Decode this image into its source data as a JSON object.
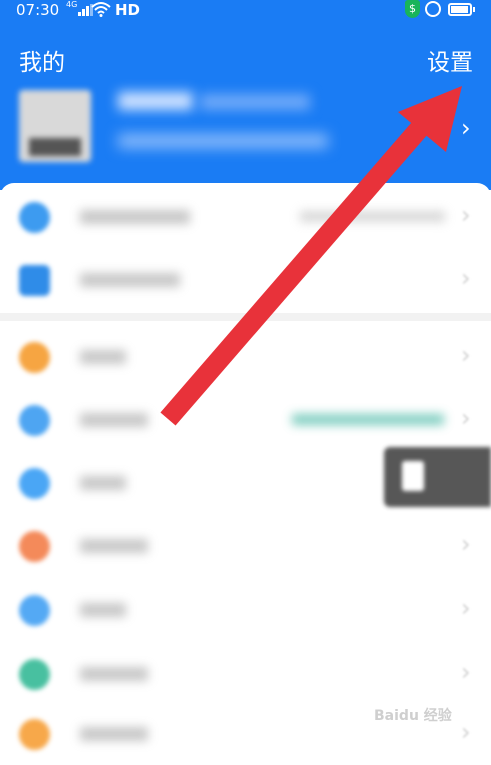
{
  "status_bar": {
    "time": "07:30",
    "signal_type": "4G",
    "network": "HD",
    "security_badge": "$"
  },
  "header": {
    "title": "我的",
    "settings_label": "设置",
    "background_color": "#1a7cf4"
  },
  "profile": {
    "chevron": "›"
  },
  "menu_groups": [
    {
      "items": [
        {
          "icon": "blue-circle-icon",
          "color": "#3d9bf0",
          "chevron": "›"
        },
        {
          "icon": "blue-doc-icon",
          "color": "#2f8ce8",
          "chevron": "›"
        }
      ]
    },
    {
      "items": [
        {
          "icon": "orange-circle-icon",
          "color": "#f6a542",
          "chevron": "›"
        },
        {
          "icon": "blue-circle-icon",
          "color": "#4ea5f2",
          "chevron": "›"
        },
        {
          "icon": "blue-circle-icon",
          "color": "#4aa6f5",
          "chevron": ""
        },
        {
          "icon": "orange-red-circle-icon",
          "color": "#f48a5a",
          "chevron": "›"
        },
        {
          "icon": "blue-circle-icon",
          "color": "#54a9f4",
          "chevron": "›"
        },
        {
          "icon": "teal-circle-icon",
          "color": "#48c0a0",
          "chevron": "›"
        },
        {
          "icon": "orange-circle-icon",
          "color": "#f7a84a",
          "chevron": "›"
        }
      ]
    }
  ],
  "annotation": {
    "arrow_color": "#e8323a"
  },
  "watermark": {
    "text": "Baidu 经验"
  }
}
